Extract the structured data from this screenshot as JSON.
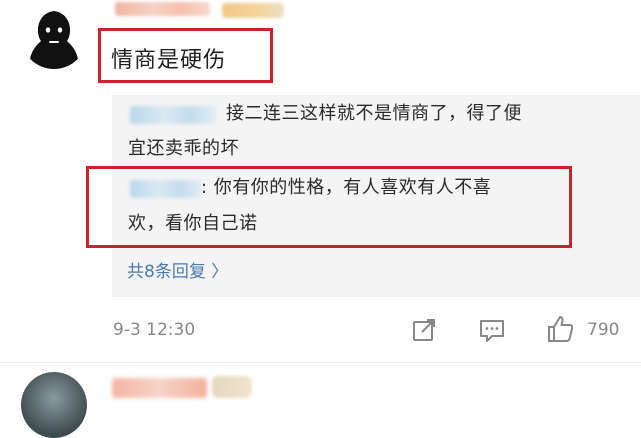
{
  "comment": {
    "text": "情商是硬伤"
  },
  "replies": [
    {
      "line1": "接二连三这样就不是情商了，得了便",
      "line2": "宜还卖乖的坏"
    },
    {
      "line1": ": 你有你的性格，有人喜欢有人不喜",
      "line2": "欢，看你自己诺"
    }
  ],
  "more_replies": "共8条回复 〉",
  "footer": {
    "timestamp": "9-3 12:30",
    "like_count": "790",
    "icons": [
      "share-icon",
      "comment-icon",
      "like-icon"
    ]
  },
  "colors": {
    "highlight": "#c8242c",
    "link": "#4a7ab0",
    "reply_bg": "#f4f4f4"
  }
}
